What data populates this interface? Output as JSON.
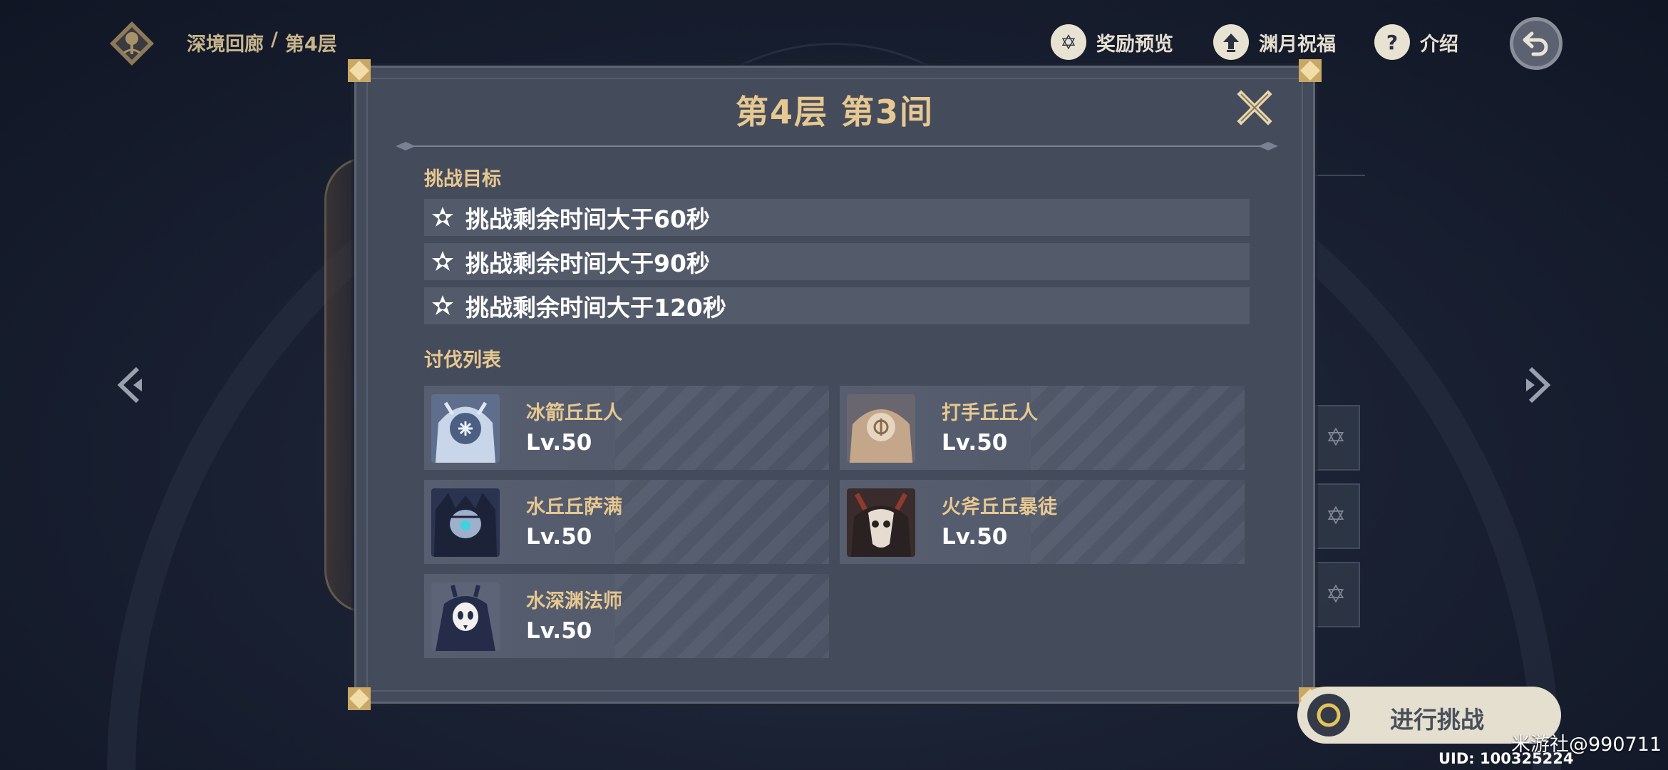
{
  "topbar": {
    "breadcrumb_section": "深境回廊",
    "breadcrumb_sep": "/",
    "breadcrumb_floor": "第4层",
    "actions": {
      "rewards_label": "奖励预览",
      "blessing_label": "渊月祝福",
      "intro_label": "介绍"
    }
  },
  "modal": {
    "title": "第4层 第3间",
    "goals_label": "挑战目标",
    "goals": [
      "挑战剩余时间大于60秒",
      "挑战剩余时间大于90秒",
      "挑战剩余时间大于120秒"
    ],
    "enemies_label": "讨伐列表",
    "enemies": [
      {
        "name": "冰箭丘丘人",
        "level": "Lv.50",
        "icon": "ice-archer-hilichurl-icon"
      },
      {
        "name": "打手丘丘人",
        "level": "Lv.50",
        "icon": "fighter-hilichurl-icon"
      },
      {
        "name": "水丘丘萨满",
        "level": "Lv.50",
        "icon": "hydro-samachurl-icon"
      },
      {
        "name": "火斧丘丘暴徒",
        "level": "Lv.50",
        "icon": "pyro-axe-mitachurl-icon"
      },
      {
        "name": "水深渊法师",
        "level": "Lv.50",
        "icon": "hydro-abyss-mage-icon"
      }
    ]
  },
  "start_button_label": "进行挑战",
  "watermark": "米游社@990711",
  "uid": "UID: 100325224",
  "colors": {
    "accent_gold": "#e7c891",
    "panel": "#444b5b",
    "row": "#535a6a"
  }
}
